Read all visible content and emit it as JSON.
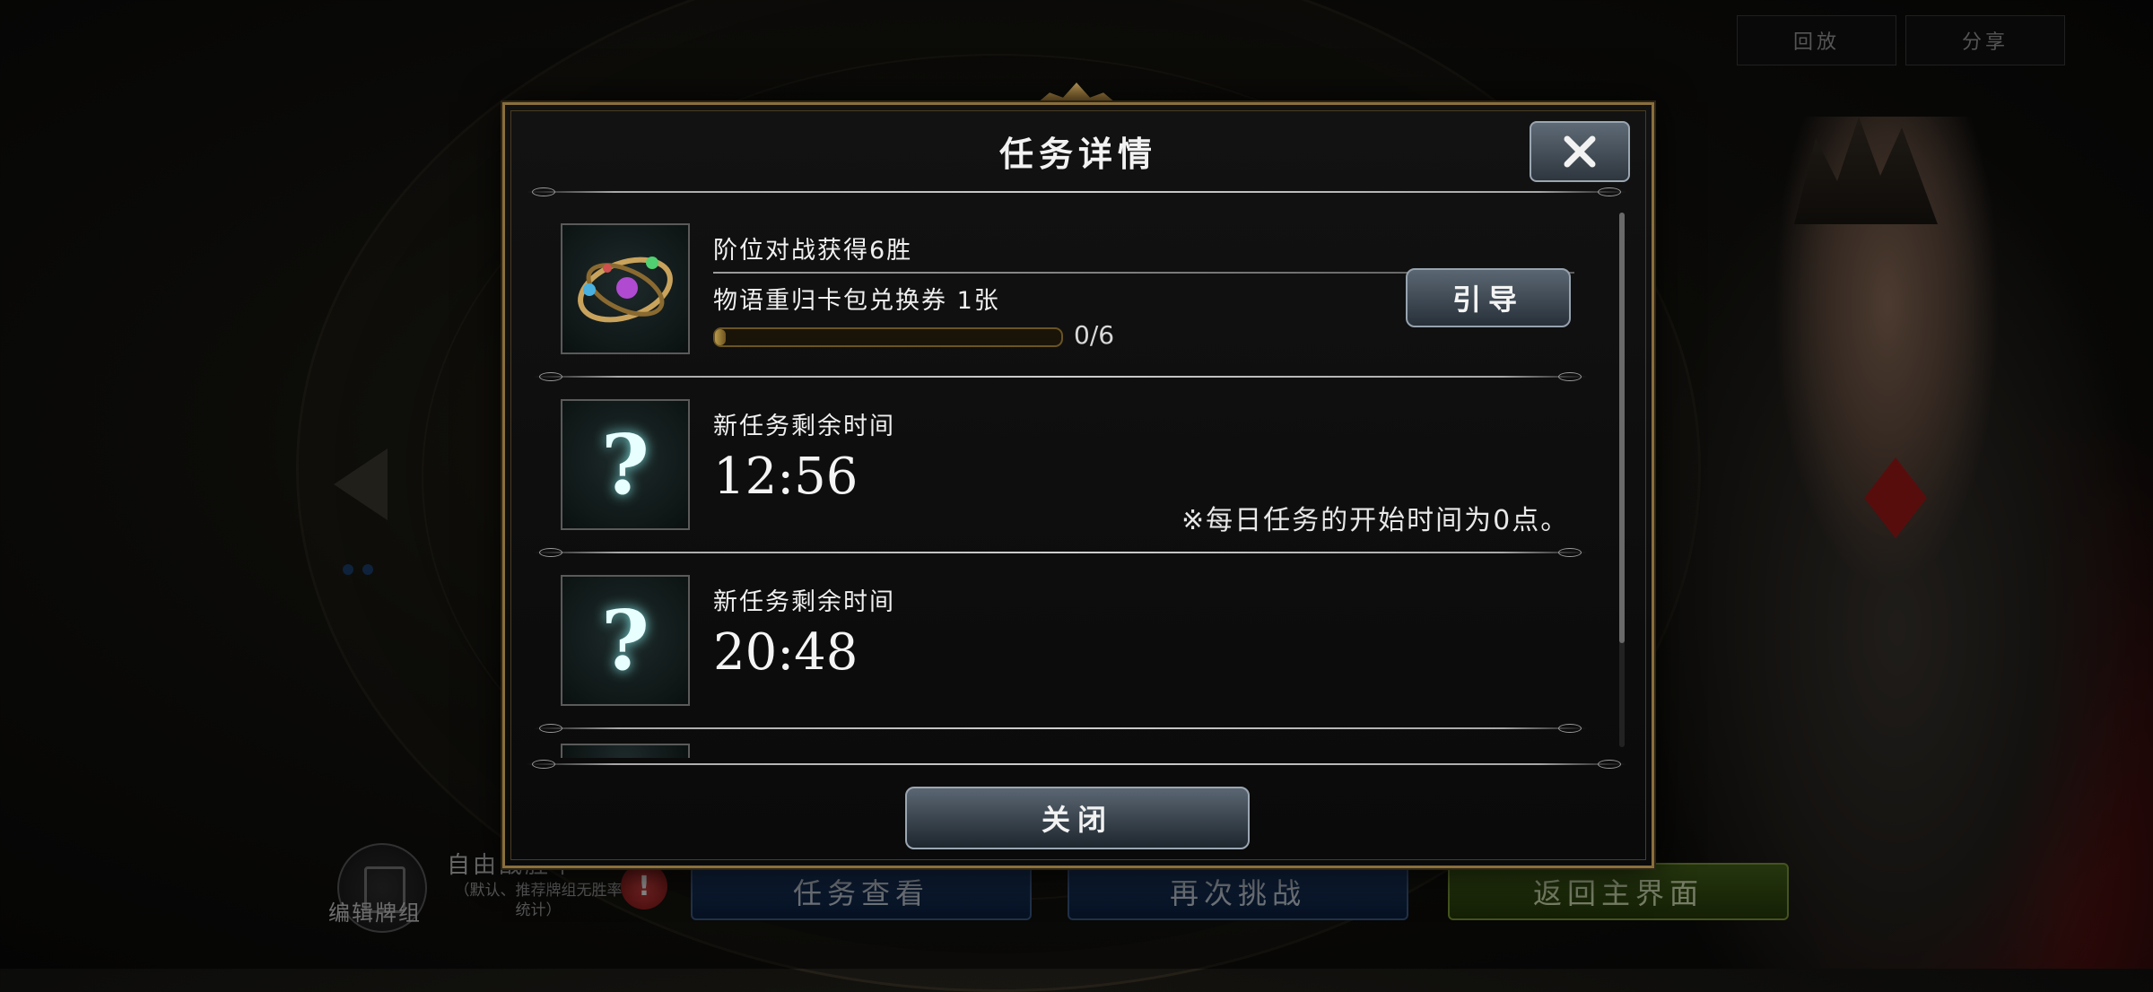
{
  "top_bar": {
    "replay_label": "回放",
    "share_label": "分享"
  },
  "bottom_bar": {
    "deck_label": "编辑牌组",
    "winrate_title": "自由战胜率",
    "winrate_note": "（默认、推荐牌组无胜率统计）",
    "alert_badge": "!",
    "task_view_label": "任务查看",
    "rechallenge_label": "再次挑战",
    "return_main_label": "返回主界面"
  },
  "dialog": {
    "title": "任务详情",
    "close_icon": "close-icon",
    "close_button_label": "关闭",
    "tasks": [
      {
        "name": "阶位对战获得6胜",
        "reward": "物语重归卡包兑换券 1张",
        "progress_text": "0/6",
        "progress_fraction": 0,
        "guide_label": "引导",
        "icon": "orb-artifact-icon"
      },
      {
        "label": "新任务剩余时间",
        "time": "12:56",
        "note": "※每日任务的开始时间为0点。",
        "icon": "question-mark-icon"
      },
      {
        "label": "新任务剩余时间",
        "time": "20:48",
        "icon": "question-mark-icon"
      }
    ]
  },
  "colors": {
    "frame_gold": "#8a6f3c",
    "button_steel": "#5a6672",
    "bottom_blue": "#1c3a66",
    "bottom_green": "#44621a",
    "alert_red": "#d24040"
  }
}
